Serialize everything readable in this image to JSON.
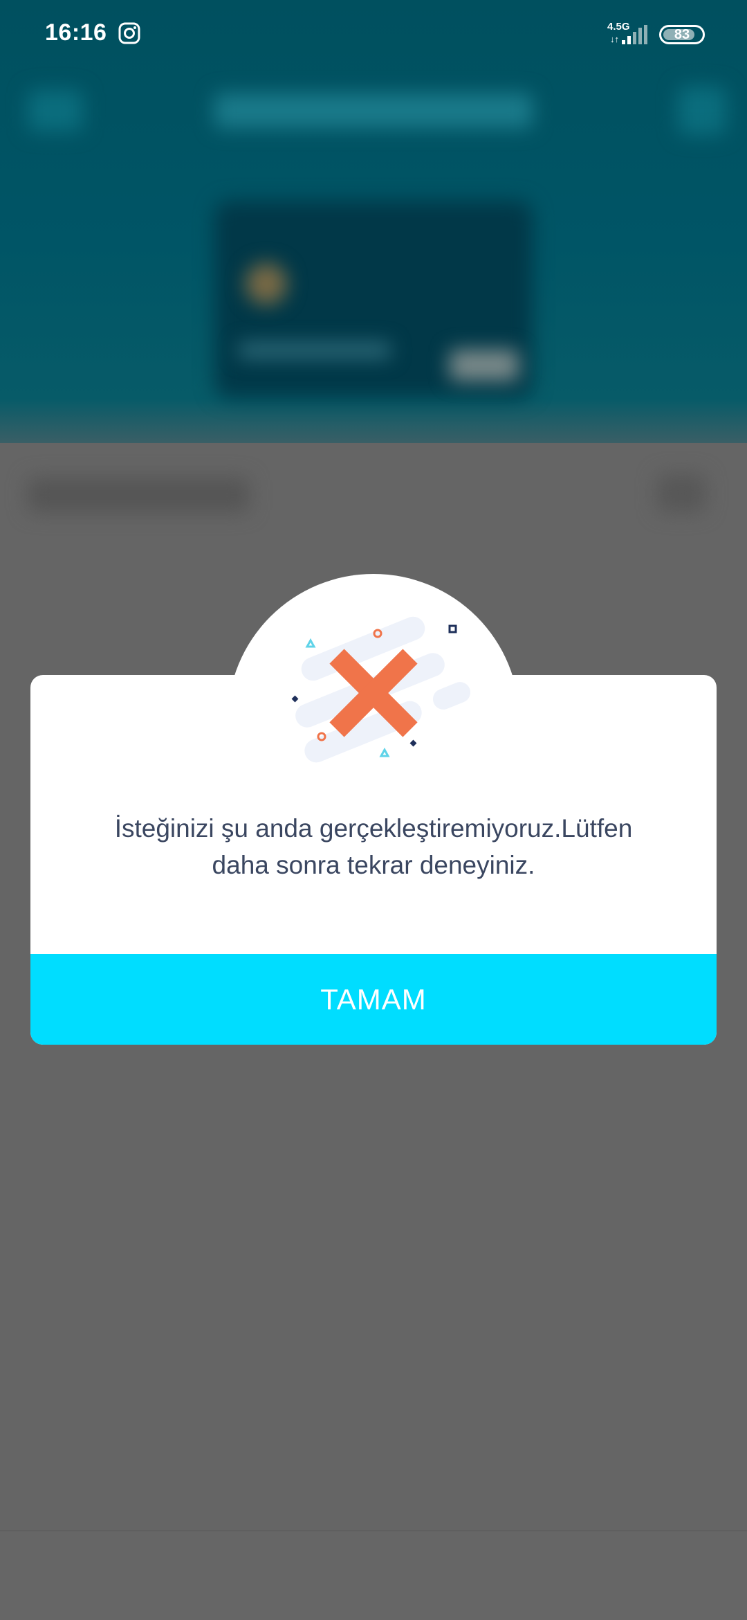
{
  "status_bar": {
    "time": "16:16",
    "notification_icon": "instagram-icon",
    "network_type": "4.5G",
    "network_activity": "↓↑",
    "battery_level": "83",
    "battery_fraction": 0.83
  },
  "dialog": {
    "icon": "error-x-icon",
    "message_line1": "İsteğinizi şu anda gerçekleştiremiyoruz.Lütfen",
    "message_line2": "daha sonra tekrar deneyiniz.",
    "ok_label": "TAMAM",
    "colors": {
      "button": "#00ddff",
      "x_mark": "#f0744a",
      "message_text": "#3a4660"
    }
  }
}
